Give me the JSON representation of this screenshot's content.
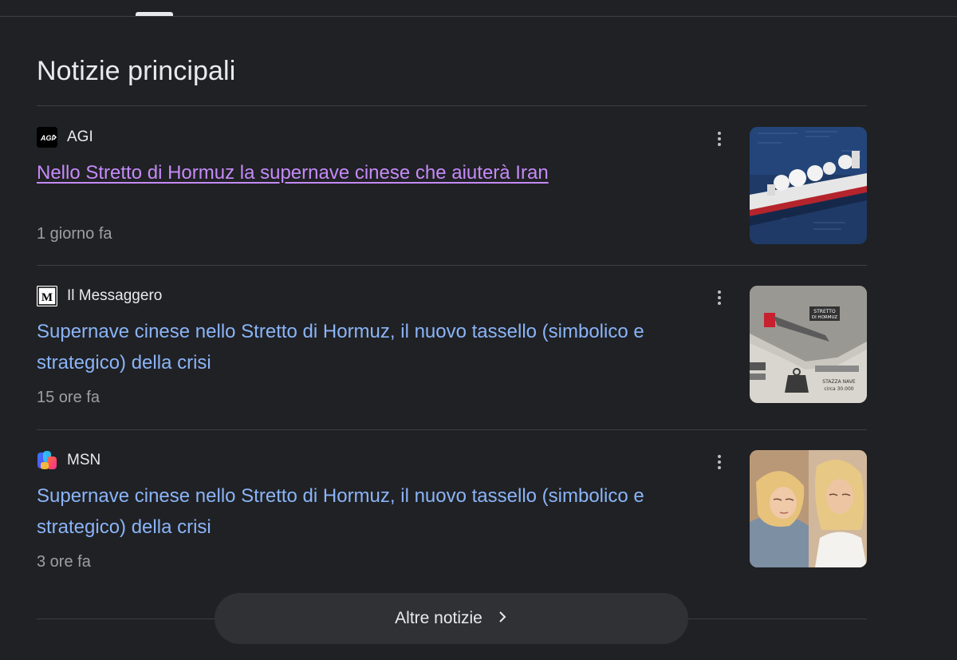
{
  "section": {
    "title": "Notizie principali"
  },
  "articles": [
    {
      "source": "AGI",
      "favicon": "agi-logo",
      "headline": "Nello Stretto di Hormuz la supernave cinese che aiuterà Iran",
      "time": "1 giorno fa",
      "visited": true,
      "thumbnail": "ship-infographic"
    },
    {
      "source": "Il Messaggero",
      "favicon": "il-messaggero-logo",
      "headline": "Supernave cinese nello Stretto di Hormuz, il nuovo tassello (simbolico e strategico) della crisi",
      "time": "15 ore fa",
      "visited": false,
      "thumbnail": "hormuz-map-infographic"
    },
    {
      "source": "MSN",
      "favicon": "msn-logo",
      "headline": "Supernave cinese nello Stretto di Hormuz, il nuovo tassello (simbolico e strategico) della crisi",
      "time": "3 ore fa",
      "visited": false,
      "thumbnail": "sleeping-woman-image"
    }
  ],
  "more_news": {
    "label": "Altre notizie"
  },
  "colors": {
    "background": "#202124",
    "link": "#8ab4f8",
    "visited_link": "#c58af9",
    "secondary_text": "#9aa0a6",
    "divider": "#3c4043",
    "button": "#303134"
  }
}
